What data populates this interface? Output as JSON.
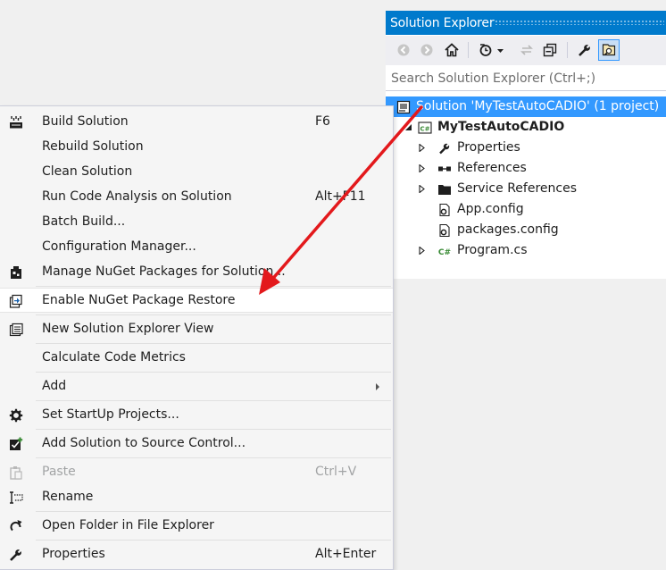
{
  "solution_explorer": {
    "title": "Solution Explorer",
    "search_placeholder": "Search Solution Explorer (Ctrl+;)",
    "toolbar": [
      "back-icon",
      "forward-icon",
      "home-icon",
      "history-icon",
      "sync-icon",
      "collapse-all-icon",
      "properties-wrench-icon",
      "preview-selected-icon"
    ],
    "tree": {
      "solution": "Solution 'MyTestAutoCADIO' (1 project)",
      "project": "MyTestAutoCADIO",
      "items": [
        "Properties",
        "References",
        "Service References",
        "App.config",
        "packages.config",
        "Program.cs"
      ]
    }
  },
  "context_menu": {
    "items": [
      {
        "label": "Build Solution",
        "shortcut": "F6"
      },
      {
        "label": "Rebuild Solution",
        "shortcut": ""
      },
      {
        "label": "Clean Solution",
        "shortcut": ""
      },
      {
        "label": "Run Code Analysis on Solution",
        "shortcut": "Alt+F11"
      },
      {
        "label": "Batch Build...",
        "shortcut": ""
      },
      {
        "label": "Configuration Manager...",
        "shortcut": ""
      },
      {
        "label": "Manage NuGet Packages for Solution...",
        "shortcut": ""
      },
      {
        "label": "Enable NuGet Package Restore",
        "shortcut": ""
      },
      {
        "label": "New Solution Explorer View",
        "shortcut": ""
      },
      {
        "label": "Calculate Code Metrics",
        "shortcut": ""
      },
      {
        "label": "Add",
        "shortcut": ""
      },
      {
        "label": "Set StartUp Projects...",
        "shortcut": ""
      },
      {
        "label": "Add Solution to Source Control...",
        "shortcut": ""
      },
      {
        "label": "Paste",
        "shortcut": "Ctrl+V"
      },
      {
        "label": "Rename",
        "shortcut": ""
      },
      {
        "label": "Open Folder in File Explorer",
        "shortcut": ""
      },
      {
        "label": "Properties",
        "shortcut": "Alt+Enter"
      }
    ]
  },
  "colors": {
    "title_bar": "#007acc",
    "selection": "#3399ff",
    "arrow": "#e3191c",
    "menu_background": "#f5f5f5"
  }
}
